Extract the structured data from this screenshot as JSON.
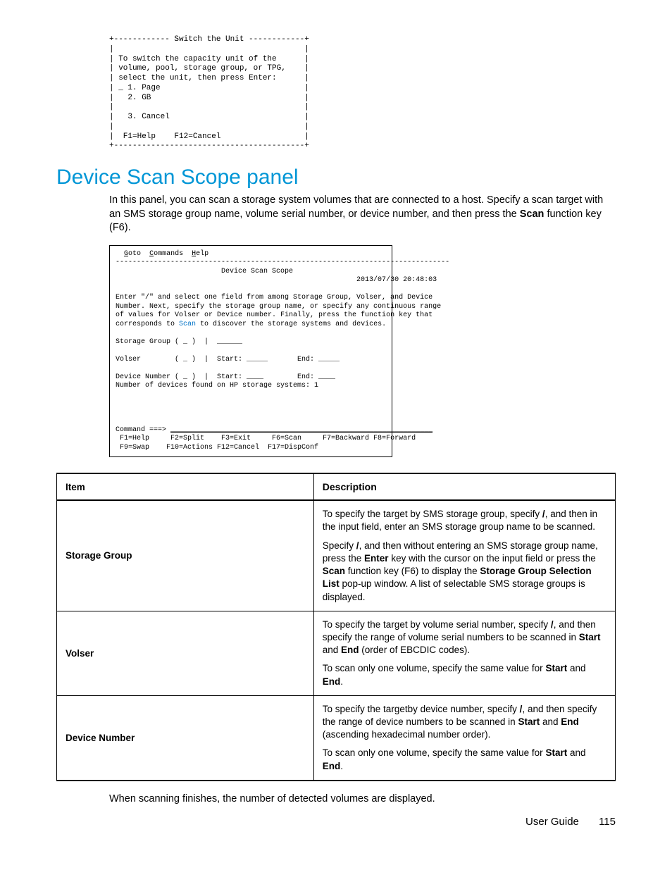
{
  "switch_unit_block": "+------------ Switch the Unit ------------+\n|                                         |\n| To switch the capacity unit of the      |\n| volume, pool, storage group, or TPG,    |\n| select the unit, then press Enter:      |\n| _ 1. Page                               |\n|   2. GB                                 |\n|                                         |\n|   3. Cancel                             |\n|                                         |\n|  F1=Help    F12=Cancel                  |\n+-----------------------------------------+",
  "heading": "Device Scan Scope panel",
  "intro": {
    "p1a": "In this panel, you can scan a storage system volumes that are connected to a host. Specify a scan target with an SMS storage group name, volume serial number, or device number, and then press the ",
    "scan": "Scan",
    "p1b": " function key (F6)."
  },
  "screen": {
    "menu_goto": "G",
    "menu_goto_rest": "oto",
    "menu_commands": "C",
    "menu_commands_rest": "ommands",
    "menu_help": "H",
    "menu_help_rest": "elp",
    "divider": "-------------------------------------------------------------------------------",
    "title": "                         Device Scan Scope",
    "timestamp": "                                                         2013/07/30 20:48:03",
    "instr1": "Enter \"/\" and select one field from among Storage Group, Volser, and Device",
    "instr2": "Number. Next, specify the storage group name, or specify any continuous range",
    "instr3": "of values for Volser or Device number. Finally, press the function key that",
    "instr4a": "corresponds to ",
    "instr4_scan": "Scan",
    "instr4b": " to discover the storage systems and devices.",
    "row_sg": "Storage Group ( _ )  |  ______",
    "row_volser": "Volser        ( _ )  |  Start: _____       End: _____",
    "row_devnum": "Device Number ( _ )  |  Start: ____        End: ____",
    "row_found": "Number of devices found on HP storage systems: 1",
    "cmd_label": "Command ===> ",
    "cmd_line": "______________________________________________________________",
    "fkeys1": " F1=Help     F2=Split    F3=Exit     F6=Scan     F7=Backward F8=Forward",
    "fkeys2": " F9=Swap    F10=Actions F12=Cancel  F17=DispConf"
  },
  "table": {
    "header_item": "Item",
    "header_desc": "Description",
    "rows": [
      {
        "item": "Storage Group",
        "desc": {
          "p1": "To specify the target by SMS storage group, specify <b>/</b>, and then in the input field, enter an SMS storage group name to be scanned.",
          "p2": "Specify <b>/</b>, and then without entering an SMS storage group name, press the <b>Enter</b> key with the cursor on the input field or press the <b>Scan</b> function key (F6) to display the <b>Storage Group Selection List</b> pop-up window. A list of selectable SMS storage groups is displayed."
        }
      },
      {
        "item": "Volser",
        "desc": {
          "p1": "To specify the target by volume serial number, specify <b>/</b>, and then specify the range of volume serial numbers to be scanned in <b>Start</b> and <b>End</b> (order of EBCDIC codes).",
          "p2": "To scan only one volume, specify the same value for <b>Start</b> and <b>End</b>."
        }
      },
      {
        "item": "Device Number",
        "desc": {
          "p1": "To specify the targetby device number, specify <b>/</b>, and then specify the range of device numbers to be scanned in <b>Start</b> and <b>End</b> (ascending hexadecimal number order).",
          "p2": "To scan only one volume, specify the same value for <b>Start</b> and <b>End</b>."
        }
      }
    ]
  },
  "closing": "When scanning finishes, the number of detected volumes are displayed.",
  "footer_label": "User Guide",
  "footer_page": "115"
}
